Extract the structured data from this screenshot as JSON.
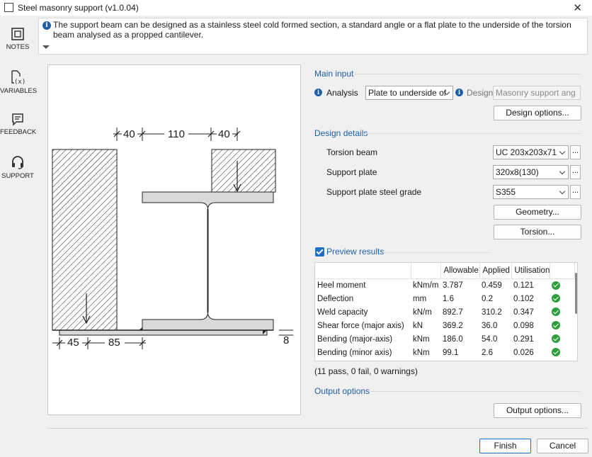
{
  "window": {
    "title": "Steel masonry support (v1.0.04)",
    "close_glyph": "✕"
  },
  "sidebar": {
    "items": [
      {
        "label": "NOTES",
        "icon": "notes-icon"
      },
      {
        "label": "VARIABLES",
        "icon": "variables-icon"
      },
      {
        "label": "FEEDBACK",
        "icon": "feedback-icon"
      },
      {
        "label": "SUPPORT",
        "icon": "headset-icon"
      }
    ]
  },
  "info": {
    "text": "The support beam can be designed as a stainless steel cold formed section, a standard angle or a flat plate to the underside of the torsion beam analysed as a propped cantilever."
  },
  "drawing": {
    "dims": {
      "top_a": "40",
      "top_b": "110",
      "top_c": "40",
      "bottom_a": "45",
      "bottom_b": "85",
      "right": "8"
    }
  },
  "main_input": {
    "section": "Main input",
    "analysis_label": "Analysis",
    "analysis_value": "Plate to underside of",
    "design_label": "Design",
    "design_value": "Masonry support ang",
    "design_options_btn": "Design options..."
  },
  "design_details": {
    "section": "Design details",
    "torsion_beam_label": "Torsion beam",
    "torsion_beam_value": "UC 203x203x71",
    "support_plate_label": "Support plate",
    "support_plate_value": "320x8(130)",
    "steel_grade_label": "Support plate steel grade",
    "steel_grade_value": "S355",
    "geometry_btn": "Geometry...",
    "torsion_btn": "Torsion...",
    "more_glyph": "..."
  },
  "preview": {
    "label": "Preview results",
    "checked": true,
    "columns": [
      "",
      "",
      "Allowable",
      "Applied",
      "Utilisation",
      ""
    ],
    "rows": [
      {
        "name": "Heel moment",
        "unit": "kNm/m",
        "allowable": "3.787",
        "applied": "0.459",
        "utilisation": "0.121",
        "status": "pass"
      },
      {
        "name": "Deflection",
        "unit": "mm",
        "allowable": "1.6",
        "applied": "0.2",
        "utilisation": "0.102",
        "status": "pass"
      },
      {
        "name": "Weld capacity",
        "unit": "kN/m",
        "allowable": "892.7",
        "applied": "310.2",
        "utilisation": "0.347",
        "status": "pass"
      },
      {
        "name": "Shear force (major axis)",
        "unit": "kN",
        "allowable": "369.2",
        "applied": "36.0",
        "utilisation": "0.098",
        "status": "pass"
      },
      {
        "name": "Bending (major-axis)",
        "unit": "kNm",
        "allowable": "186.0",
        "applied": "54.0",
        "utilisation": "0.291",
        "status": "pass"
      },
      {
        "name": "Bending (minor axis)",
        "unit": "kNm",
        "allowable": "99.1",
        "applied": "2.6",
        "utilisation": "0.026",
        "status": "pass"
      }
    ],
    "summary": "(11 pass, 0 fail, 0 warnings)"
  },
  "output": {
    "section": "Output options",
    "button": "Output options..."
  },
  "footer": {
    "finish": "Finish",
    "cancel": "Cancel"
  },
  "colors": {
    "accent": "#1f5fa8",
    "pass": "#2e9e3e"
  }
}
